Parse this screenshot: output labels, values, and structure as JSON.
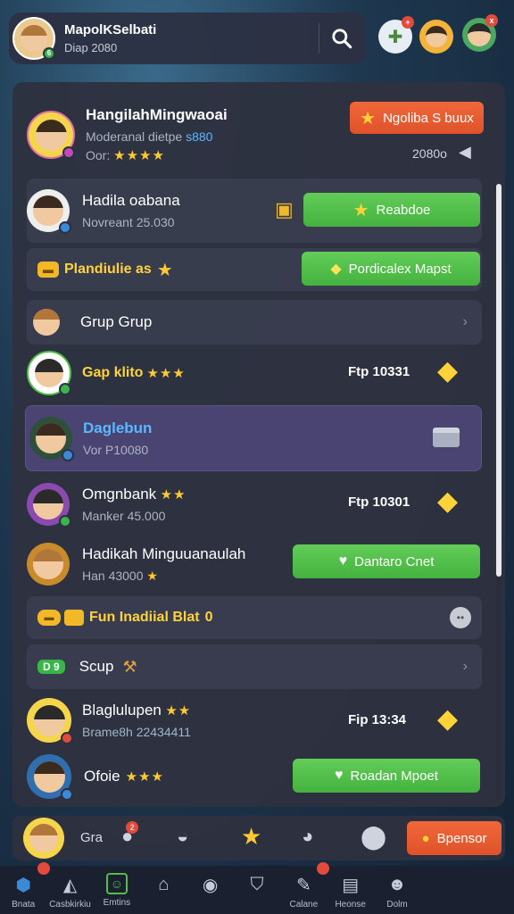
{
  "header": {
    "title": "MapolKSelbati",
    "subtitle": "Diap 2080"
  },
  "featured": {
    "name": "HangilahMingwaoai",
    "meta": "Moderanal dietpe",
    "meta_highlight": "s880",
    "meta2": "Oor:",
    "stars": "★★★★",
    "button": "Ngoliba S buux",
    "price": "2080o"
  },
  "rows": [
    {
      "name": "Hadila oabana",
      "meta": "Novreant 25.030",
      "button": "Reabdoe"
    },
    {
      "name": "Plandiulie as",
      "button": "Pordicalex Mapst"
    },
    {
      "name": "Grup Grup"
    },
    {
      "name": "Gap klito",
      "stars": "★★★",
      "price": "Ftp 10331"
    },
    {
      "name": "Daglebun",
      "meta": "Vor P10080"
    },
    {
      "name": "Omgnbank",
      "stars": "★★",
      "meta": "Manker 45.000",
      "price": "Ftp 10301"
    },
    {
      "name": "Hadikah Minguuanaulah",
      "meta": "Han 43000",
      "button": "Dantaro Cnet"
    },
    {
      "name": "Fun Inadiial Blat",
      "tag": "0"
    },
    {
      "name": "Scup",
      "tag": "D 9"
    },
    {
      "name": "Blaglulupen",
      "stars": "★★",
      "meta": "Brame8h 22434411",
      "price": "Fip 13:34"
    },
    {
      "name": "Ofoie",
      "stars": "★★★",
      "button": "Roadan Mpoet"
    }
  ],
  "actionbar": {
    "label": "Gra",
    "badge": "2",
    "button": "Bpensor"
  },
  "nav": [
    {
      "label": "Bnata",
      "icon": "shield-icon"
    },
    {
      "label": "Casbkirkiu",
      "icon": "hat-icon"
    },
    {
      "label": "Emtins",
      "icon": "smile-icon"
    },
    {
      "label": "",
      "icon": "house-icon"
    },
    {
      "label": "",
      "icon": "planet-icon"
    },
    {
      "label": "",
      "icon": "shield-outline-icon"
    },
    {
      "label": "Calane",
      "icon": "pencil-icon"
    },
    {
      "label": "Heonse",
      "icon": "book-icon"
    },
    {
      "label": "Dolm",
      "icon": "user-icon"
    }
  ],
  "colors": {
    "green_button": "#4fbf45",
    "orange_button": "#e8592e",
    "highlight_row": "#4a4472",
    "accent_text": "#5ab8ff",
    "star": "#ffc933"
  }
}
